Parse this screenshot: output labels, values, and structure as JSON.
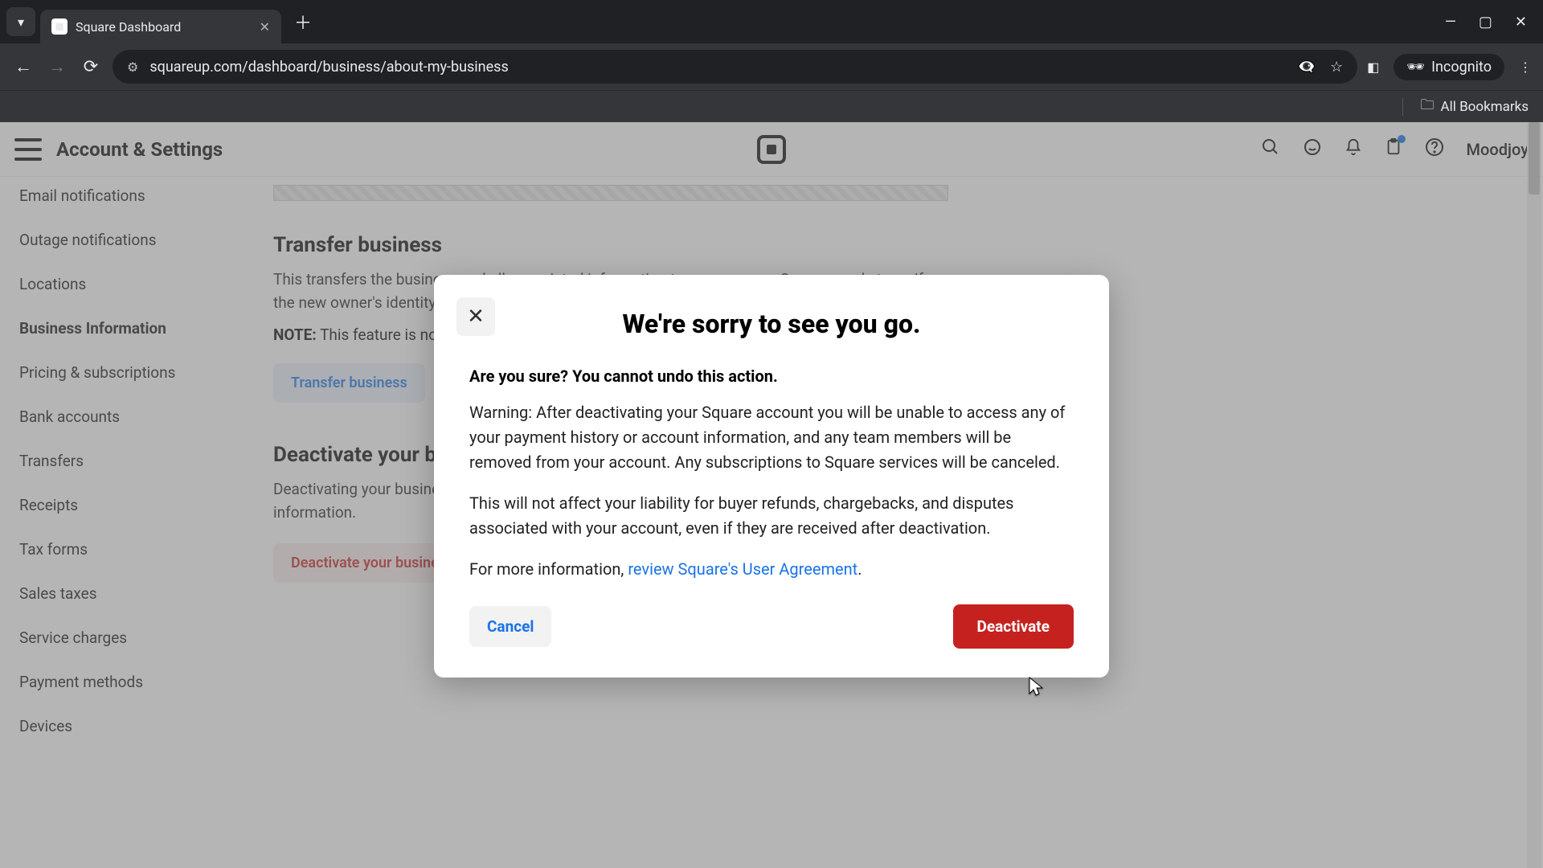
{
  "browser": {
    "tab_title": "Square Dashboard",
    "url": "squareup.com/dashboard/business/about-my-business",
    "incognito_label": "Incognito",
    "all_bookmarks": "All Bookmarks"
  },
  "appbar": {
    "title": "Account & Settings",
    "user": "Moodjoy"
  },
  "sidebar": {
    "items": [
      {
        "label": "Email notifications"
      },
      {
        "label": "Outage notifications"
      },
      {
        "label": "Locations"
      },
      {
        "label": "Business Information"
      },
      {
        "label": "Pricing & subscriptions"
      },
      {
        "label": "Bank accounts"
      },
      {
        "label": "Transfers"
      },
      {
        "label": "Receipts"
      },
      {
        "label": "Tax forms"
      },
      {
        "label": "Sales taxes"
      },
      {
        "label": "Service charges"
      },
      {
        "label": "Payment methods"
      },
      {
        "label": "Devices"
      }
    ],
    "active_index": 3
  },
  "main": {
    "transfer": {
      "title": "Transfer business",
      "body": "This transfers the business and all associated information to a new owner. Square needs to verify the new owner's identity, so have them available during the transfer process.",
      "note_label": "NOTE:",
      "note_text": "This feature is not available in all regions.",
      "button": "Transfer business"
    },
    "deactivate": {
      "title": "Deactivate your business",
      "body": "Deactivating your business means that you will be unable to access any payment history or account information.",
      "button": "Deactivate your business"
    }
  },
  "modal": {
    "title": "We're sorry to see you go.",
    "confirm": "Are you sure? You cannot undo this action.",
    "p1": "Warning: After deactivating your Square account you will be unable to access any of your payment history or account information, and any team members will be removed from your account. Any subscriptions to Square services will be canceled.",
    "p2": "This will not affect your liability for buyer refunds, chargebacks, and disputes associated with your account, even if they are received after deactivation.",
    "p3_prefix": "For more information, ",
    "p3_link": "review Square's User Agreement",
    "p3_suffix": ".",
    "cancel": "Cancel",
    "deactivate": "Deactivate"
  }
}
